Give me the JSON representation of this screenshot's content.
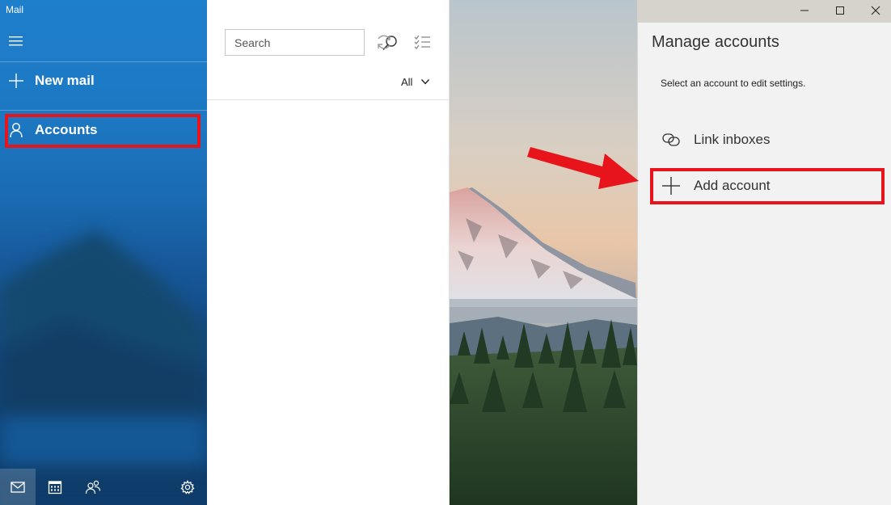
{
  "window": {
    "app_title": "Mail",
    "controls": [
      "minimize-icon",
      "maximize-icon",
      "close-icon"
    ]
  },
  "nav": {
    "menu_icon": "hamburger-icon",
    "new_mail": {
      "label": "New mail",
      "icon": "plus-icon"
    },
    "accounts": {
      "label": "Accounts",
      "icon": "person-icon",
      "highlighted": true
    },
    "bottom_icons": [
      "mail-icon",
      "calendar-icon",
      "people-icon",
      "settings-icon"
    ],
    "active_bottom_icon": "mail-icon"
  },
  "message_list": {
    "search": {
      "placeholder": "Search",
      "value": "",
      "icon": "search-icon"
    },
    "toolbar_icons": [
      "sync-icon",
      "selection-mode-icon"
    ],
    "filter": {
      "label": "All",
      "icon": "chevron-down-icon"
    }
  },
  "manage_accounts": {
    "title": "Manage accounts",
    "subtitle": "Select an account to edit settings.",
    "items": [
      {
        "label": "Link inboxes",
        "icon": "link-inboxes-icon"
      },
      {
        "label": "Add account",
        "icon": "plus-icon",
        "highlighted": true
      }
    ]
  },
  "annotations": {
    "highlight_color": "#e8141c",
    "arrow_target": "Add account"
  },
  "colors": {
    "nav_blue": "#1e7fcd",
    "panel_bg": "#f2f2f2"
  }
}
